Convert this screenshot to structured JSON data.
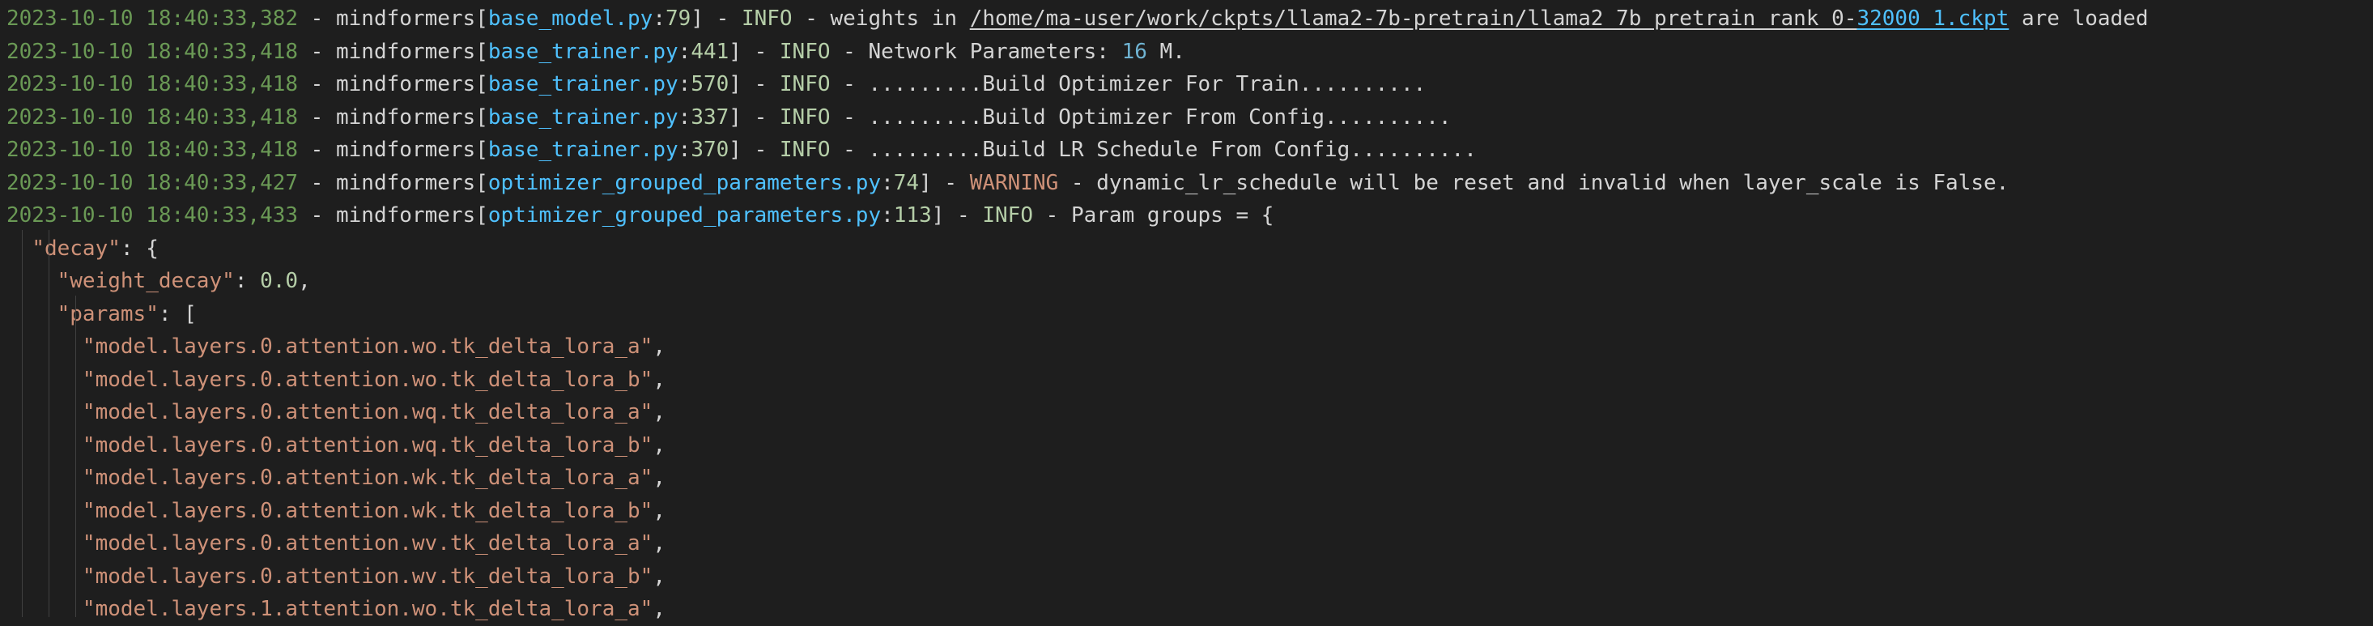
{
  "log_lines": [
    {
      "timestamp": "2023-10-10 18:40:33,382",
      "logger": "mindformers",
      "file": "base_model.py",
      "lineno": "79",
      "level": "INFO",
      "msg_pre": "weights in ",
      "path_main": "/home/ma-user/work/ckpts/llama2-7b-pretrain/llama2_7b_pretrain_rank_0-",
      "path_link": "32000_1.ckpt",
      "msg_post": " are loaded"
    },
    {
      "timestamp": "2023-10-10 18:40:33,418",
      "logger": "mindformers",
      "file": "base_trainer.py",
      "lineno": "441",
      "level": "INFO",
      "msg_pre": "Network Parameters: ",
      "msg_num": "16",
      "msg_post": " M."
    },
    {
      "timestamp": "2023-10-10 18:40:33,418",
      "logger": "mindformers",
      "file": "base_trainer.py",
      "lineno": "570",
      "level": "INFO",
      "msg": ".........Build Optimizer For Train.........."
    },
    {
      "timestamp": "2023-10-10 18:40:33,418",
      "logger": "mindformers",
      "file": "base_trainer.py",
      "lineno": "337",
      "level": "INFO",
      "msg": ".........Build Optimizer From Config.........."
    },
    {
      "timestamp": "2023-10-10 18:40:33,418",
      "logger": "mindformers",
      "file": "base_trainer.py",
      "lineno": "370",
      "level": "INFO",
      "msg": ".........Build LR Schedule From Config.........."
    },
    {
      "timestamp": "2023-10-10 18:40:33,427",
      "logger": "mindformers",
      "file": "optimizer_grouped_parameters.py",
      "lineno": "74",
      "level": "WARNING",
      "msg": "dynamic_lr_schedule will be reset and invalid when layer_scale is False."
    },
    {
      "timestamp": "2023-10-10 18:40:33,433",
      "logger": "mindformers",
      "file": "optimizer_grouped_parameters.py",
      "lineno": "113",
      "level": "INFO",
      "msg": "Param groups = {"
    }
  ],
  "json_block": {
    "decay_key": "\"decay\"",
    "weight_decay_key": "\"weight_decay\"",
    "weight_decay_value": "0.0",
    "params_key": "\"params\"",
    "params": [
      "\"model.layers.0.attention.wo.tk_delta_lora_a\"",
      "\"model.layers.0.attention.wo.tk_delta_lora_b\"",
      "\"model.layers.0.attention.wq.tk_delta_lora_a\"",
      "\"model.layers.0.attention.wq.tk_delta_lora_b\"",
      "\"model.layers.0.attention.wk.tk_delta_lora_a\"",
      "\"model.layers.0.attention.wk.tk_delta_lora_b\"",
      "\"model.layers.0.attention.wv.tk_delta_lora_a\"",
      "\"model.layers.0.attention.wv.tk_delta_lora_b\"",
      "\"model.layers.1.attention.wo.tk_delta_lora_a\""
    ]
  },
  "colors": {
    "background": "#1e1e1e",
    "timestamp": "#6a9955",
    "file_link": "#4fc1ff",
    "info": "#b5cea8",
    "warning": "#ce9178",
    "json_string": "#ce9178"
  }
}
